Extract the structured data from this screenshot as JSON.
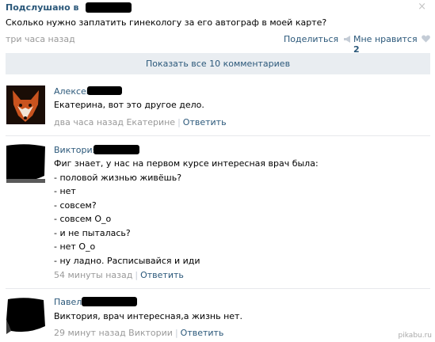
{
  "post": {
    "title": "Подслушано в",
    "text": "Сколько нужно заплатить гинекологу за его автограф в моей карте?",
    "time": "три часа назад",
    "share_label": "Поделиться",
    "like_label": "Мне нравится",
    "like_count": "2",
    "close_icon": "×"
  },
  "show_all_label": "Показать все 10 комментариев",
  "comments": [
    {
      "author": "Алексей",
      "text": "Екатерина, вот это другое дело.",
      "time": "два часа назад Екатерине",
      "reply": "Ответить"
    },
    {
      "author": "Виктория",
      "text": "Фиг знает, у нас на первом курсе интересная врач была:\n- половой жизнью живёшь?\n- нет\n- совсем?\n- совсем О_о\n- и не пыталась?\n- нет О_о\n- ну ладно. Расписывайся и иди",
      "time": "54 минуты назад",
      "reply": "Ответить"
    },
    {
      "author": "Павел",
      "text": "Виктория, врач интересная,а жизнь нет.",
      "time": "29 минут назад Виктории",
      "reply": "Ответить"
    }
  ],
  "watermark": "pikabu.ru",
  "colors": {
    "link": "#2b587a",
    "muted": "#999999",
    "button_bg": "#e9edf1"
  }
}
